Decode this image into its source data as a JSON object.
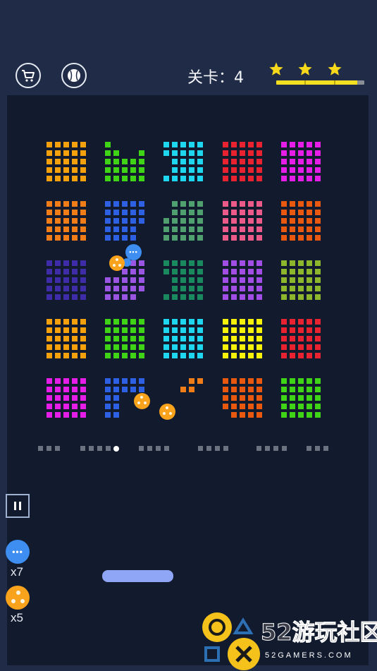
{
  "hud": {
    "level_label": "关卡：4",
    "stars_earned": 3,
    "stars_total": 3,
    "progress": 0.92
  },
  "toolbar": {
    "shop_icon": "shopping-cart-icon",
    "ball_icon": "baseball-icon",
    "pause_icon": "pause-icon"
  },
  "power_ups": [
    {
      "icon": "multi-ball-blue-icon",
      "count_label": "x7",
      "color": "#3d8ef0"
    },
    {
      "icon": "triple-ball-orange-icon",
      "count_label": "x5",
      "color": "#f9a21b"
    }
  ],
  "brick_colors": [
    [
      "#f5a10c",
      "#3fd416",
      "#1ed6ee",
      "#e8232f",
      "#e61de6"
    ],
    [
      "#f07d18",
      "#2e60e4",
      "#4f9f6f",
      "#ec5a8a",
      "#e8590f"
    ],
    [
      "#3f2ca8",
      "#9a55e2",
      "#1a8a5e",
      "#a24ee4",
      "#8cb62c"
    ],
    [
      "#f5a10c",
      "#3fd416",
      "#1ed6ee",
      "#f6f20c",
      "#e8232f"
    ],
    [
      "#e61de6",
      "#2e60e4",
      "#f07d18",
      "#e8590f",
      "#3fd416"
    ]
  ],
  "watermark": {
    "text": "52游玩社区",
    "subtext": "52GAMERS.COM"
  }
}
